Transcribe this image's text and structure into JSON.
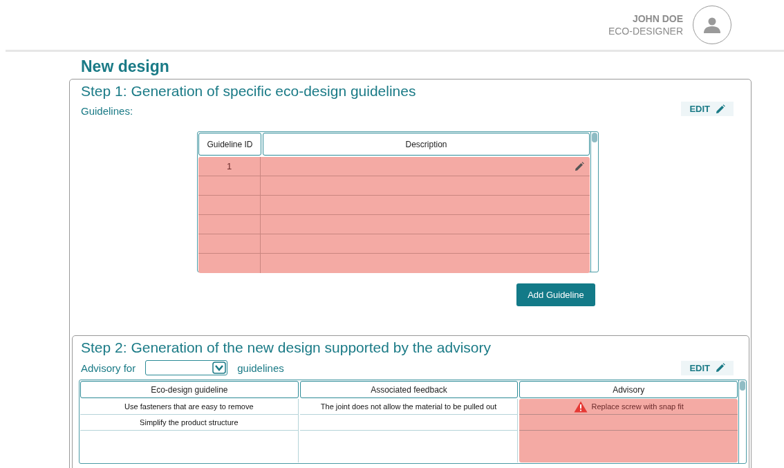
{
  "user": {
    "name": "JOHN DOE",
    "role": "ECO-DESIGNER"
  },
  "page_title": "New design",
  "step1": {
    "title": "Step 1: Generation of specific eco-design guidelines",
    "label": "Guidelines:",
    "edit_button": "EDIT",
    "table": {
      "error": true,
      "columns": [
        "Guideline ID",
        "Description"
      ],
      "rows": [
        {
          "id": "1",
          "editable": true
        },
        {
          "editable": false
        },
        {
          "editable": false
        },
        {
          "editable": false
        },
        {
          "editable": false
        },
        {
          "editable": false
        }
      ]
    },
    "add_button": "Add Guideline"
  },
  "step2": {
    "title": "Step 2: Generation of the new design supported by the advisory",
    "filter_prefix": "Advisory for",
    "filter_suffix": "guidelines",
    "edit_button": "EDIT",
    "table": {
      "columns": [
        {
          "label": "Eco-design guideline",
          "error": false
        },
        {
          "label": "Associated feedback",
          "error": false
        },
        {
          "label": "Advisory",
          "error": true
        }
      ],
      "rows": [
        {
          "guideline": "Use fasteners that are easy to remove",
          "feedback": "The joint does not allow the material to be pulled out",
          "advisory": "Replace screw with snap fit",
          "warning": true
        },
        {
          "guideline": "Simplify the product structure",
          "warning": false
        },
        {
          "warning": false
        }
      ]
    }
  }
}
